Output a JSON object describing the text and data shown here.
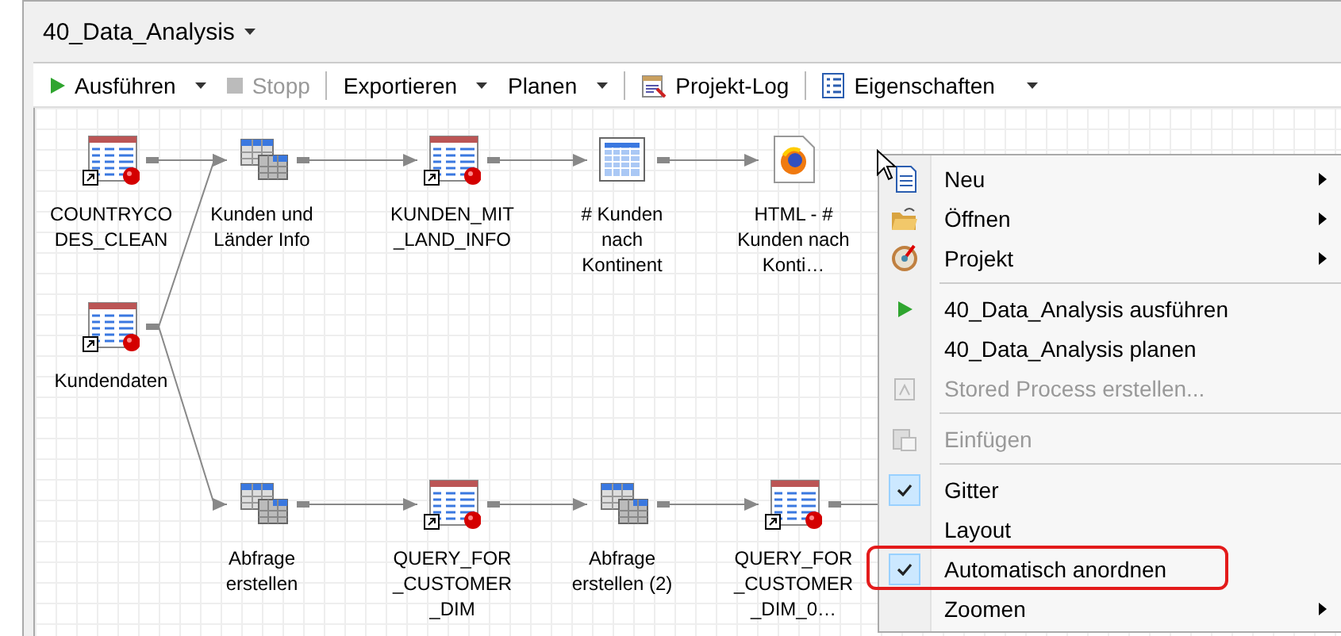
{
  "window": {
    "title": "40_Data_Analysis"
  },
  "toolbar": [
    {
      "kind": "button",
      "label": "Ausführen",
      "dropdown": true,
      "disabled": false
    },
    {
      "kind": "button",
      "label": "Stopp",
      "dropdown": false,
      "disabled": true
    },
    {
      "kind": "separator"
    },
    {
      "kind": "button",
      "label": "Exportieren",
      "dropdown": true,
      "disabled": false
    },
    {
      "kind": "button",
      "label": "Planen",
      "dropdown": true,
      "disabled": false
    },
    {
      "kind": "separator"
    },
    {
      "kind": "button",
      "label": "Projekt-Log",
      "dropdown": false,
      "disabled": false
    },
    {
      "kind": "separator"
    },
    {
      "kind": "button",
      "label": "Eigenschaften",
      "dropdown": true,
      "disabled": false
    }
  ],
  "flow": {
    "nodes": [
      {
        "kind": "dataset",
        "label": "COUNTRYCODES_CLEAN"
      },
      {
        "kind": "query",
        "label": "Kunden und Länder Info"
      },
      {
        "kind": "dataset",
        "label": "KUNDEN_MIT_LAND_INFO"
      },
      {
        "kind": "report",
        "label": "# Kunden nach Kontinent"
      },
      {
        "kind": "html",
        "label": "HTML - # Kunden nach Konti…"
      },
      {
        "kind": "dataset",
        "label": "Kundendaten"
      },
      {
        "kind": "query",
        "label": "Abfrage erstellen"
      },
      {
        "kind": "dataset",
        "label": "QUERY_FOR_CUSTOMER_DIM"
      },
      {
        "kind": "query",
        "label": "Abfrage erstellen (2)"
      },
      {
        "kind": "dataset",
        "label": "QUERY_FOR_CUSTOMER_DIM_0…"
      }
    ]
  },
  "context_menu": [
    {
      "kind": "item",
      "label": "Neu",
      "submenu": true,
      "disabled": false,
      "checked": false,
      "highlighted": false
    },
    {
      "kind": "item",
      "label": "Öffnen",
      "submenu": true,
      "disabled": false,
      "checked": false,
      "highlighted": false
    },
    {
      "kind": "item",
      "label": "Projekt",
      "submenu": true,
      "disabled": false,
      "checked": false,
      "highlighted": false
    },
    {
      "kind": "separator"
    },
    {
      "kind": "item",
      "label": "40_Data_Analysis ausführen",
      "submenu": false,
      "disabled": false,
      "checked": false,
      "highlighted": false
    },
    {
      "kind": "item",
      "label": "40_Data_Analysis planen",
      "submenu": false,
      "disabled": false,
      "checked": false,
      "highlighted": false
    },
    {
      "kind": "item",
      "label": "Stored Process erstellen...",
      "submenu": false,
      "disabled": true,
      "checked": false,
      "highlighted": false
    },
    {
      "kind": "separator"
    },
    {
      "kind": "item",
      "label": "Einfügen",
      "submenu": false,
      "disabled": true,
      "checked": false,
      "highlighted": false
    },
    {
      "kind": "separator"
    },
    {
      "kind": "item",
      "label": "Gitter",
      "submenu": false,
      "disabled": false,
      "checked": true,
      "highlighted": false
    },
    {
      "kind": "item",
      "label": "Layout",
      "submenu": false,
      "disabled": false,
      "checked": false,
      "highlighted": false
    },
    {
      "kind": "item",
      "label": "Automatisch anordnen",
      "submenu": false,
      "disabled": false,
      "checked": true,
      "highlighted": true
    },
    {
      "kind": "item",
      "label": "Zoomen",
      "submenu": true,
      "disabled": false,
      "checked": false,
      "highlighted": false
    }
  ]
}
